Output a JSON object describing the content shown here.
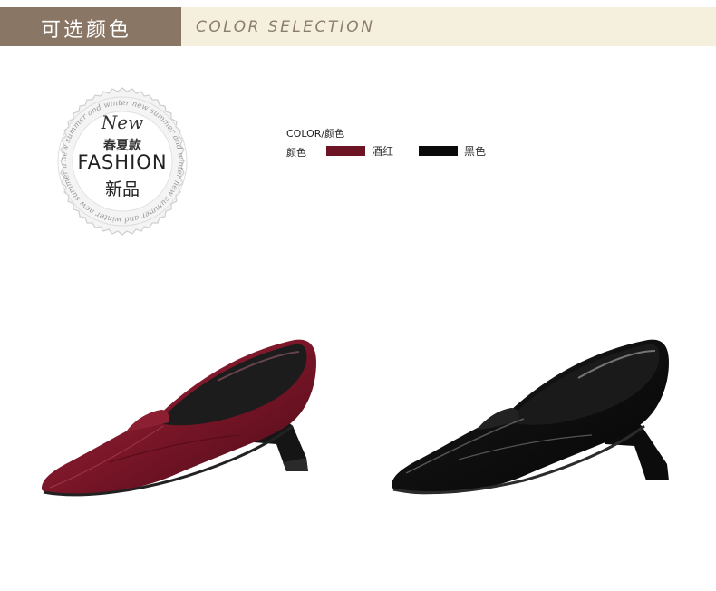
{
  "header": {
    "title_cn": "可选颜色",
    "title_en": "COLOR SELECTION"
  },
  "badge": {
    "new": "New",
    "season": "春夏款",
    "fashion": "FASHION",
    "new_product": "新品",
    "ring_text": "new summer and winter new summer and winter new summer and winter new summer and winter"
  },
  "colors": {
    "title": "COLOR/颜色",
    "label": "颜色",
    "options": [
      {
        "name": "酒红",
        "hex": "#6d1424"
      },
      {
        "name": "黑色",
        "hex": "#0a0a0a"
      }
    ]
  }
}
